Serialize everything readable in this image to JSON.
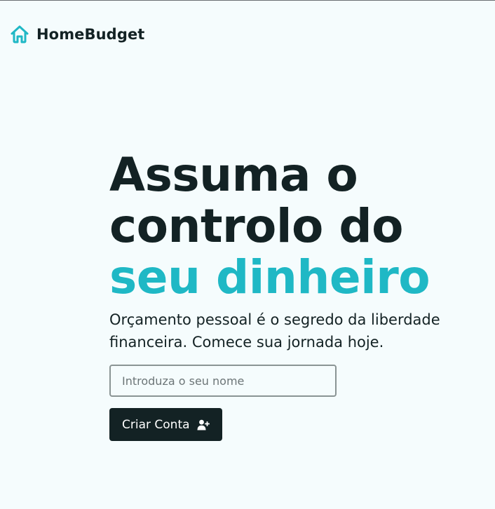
{
  "header": {
    "logo_icon": "house-icon",
    "brand_name": "HomeBudget"
  },
  "hero": {
    "headline_line1": "Assuma o",
    "headline_line2": "controlo do",
    "headline_line3": "seu dinheiro",
    "subtitle": "Orçamento pessoal é o segredo da liberdade financeira. Comece sua jornada hoje."
  },
  "form": {
    "name_input_value": "",
    "name_input_placeholder": "Introduza o seu nome",
    "create_button_label": "Criar Conta",
    "create_button_icon": "user-plus-icon"
  },
  "colors": {
    "accent": "#1fb8c5",
    "text": "#132224",
    "background": "#f5fcfd",
    "button_bg": "#132224"
  }
}
